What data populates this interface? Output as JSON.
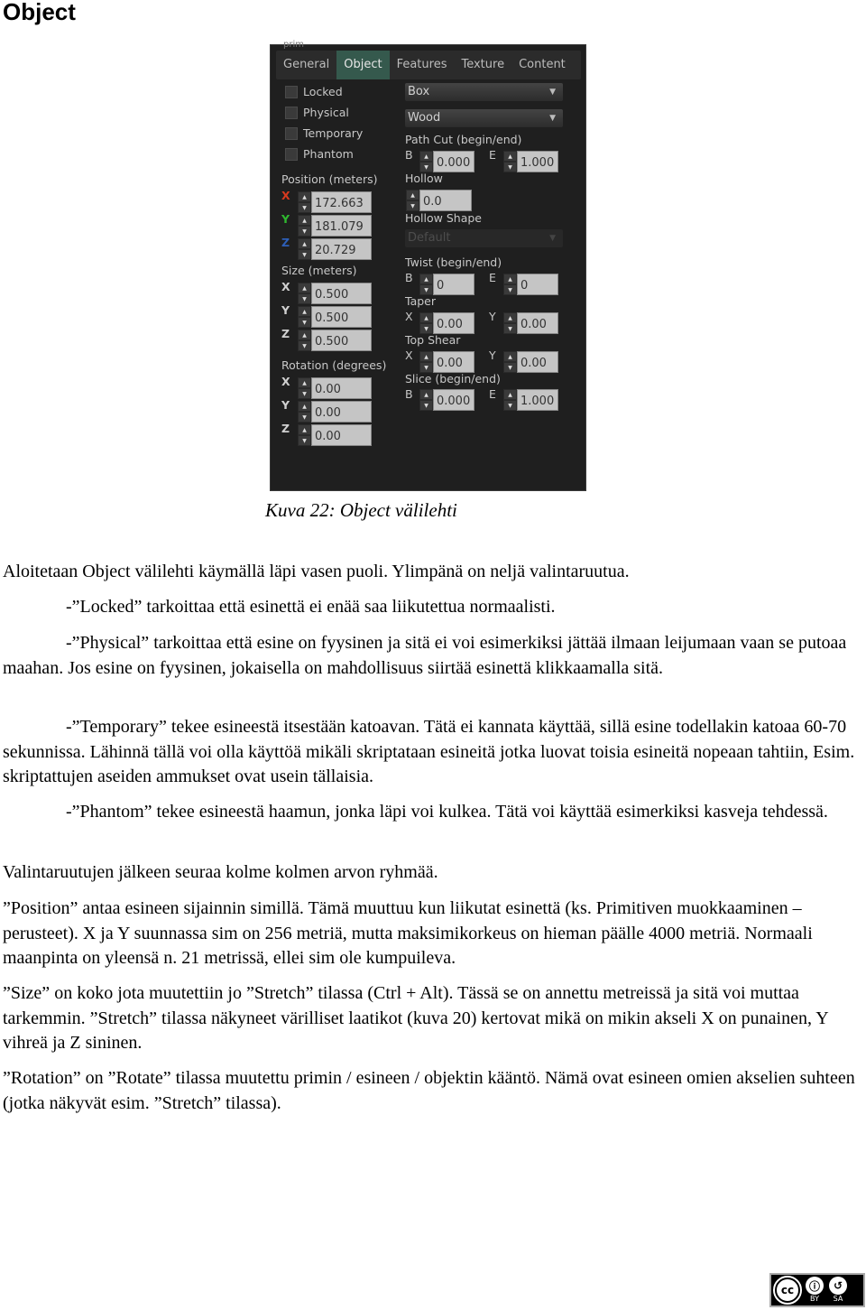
{
  "doc": {
    "title": "Object"
  },
  "panel": {
    "cut_label": "prim",
    "tabs": [
      {
        "label": "General",
        "active": false
      },
      {
        "label": "Object",
        "active": true
      },
      {
        "label": "Features",
        "active": false
      },
      {
        "label": "Texture",
        "active": false
      },
      {
        "label": "Content",
        "active": false
      }
    ],
    "checkboxes": [
      {
        "label": "Locked",
        "checked": false
      },
      {
        "label": "Physical",
        "checked": false
      },
      {
        "label": "Temporary",
        "checked": false
      },
      {
        "label": "Phantom",
        "checked": false
      }
    ],
    "position": {
      "label": "Position (meters)",
      "x_label": "X",
      "y_label": "Y",
      "z_label": "Z",
      "x": "172.663",
      "y": "181.079",
      "z": "20.729",
      "axis_colors": {
        "x": "#d83a1e",
        "y": "#2fb82f",
        "z": "#2d5fb8"
      }
    },
    "size": {
      "label": "Size (meters)",
      "x_label": "X",
      "y_label": "Y",
      "z_label": "Z",
      "x": "0.500",
      "y": "0.500",
      "z": "0.500"
    },
    "rotation": {
      "label": "Rotation (degrees)",
      "x_label": "X",
      "y_label": "Y",
      "z_label": "Z",
      "x": "0.00",
      "y": "0.00",
      "z": "0.00"
    },
    "shape_dropdown": "Box",
    "material_dropdown": "Wood",
    "path_cut": {
      "label": "Path Cut (begin/end)",
      "b_label": "B",
      "e_label": "E",
      "b": "0.000",
      "e": "1.000"
    },
    "hollow": {
      "label": "Hollow",
      "value": "0.0"
    },
    "hollow_shape": {
      "label": "Hollow Shape",
      "value": "Default"
    },
    "twist": {
      "label": "Twist (begin/end)",
      "b_label": "B",
      "e_label": "E",
      "b": "0",
      "e": "0"
    },
    "taper": {
      "label": "Taper",
      "x_label": "X",
      "y_label": "Y",
      "x": "0.00",
      "y": "0.00"
    },
    "top_shear": {
      "label": "Top Shear",
      "x_label": "X",
      "y_label": "Y",
      "x": "0.00",
      "y": "0.00"
    },
    "slice": {
      "label": "Slice (begin/end)",
      "b_label": "B",
      "e_label": "E",
      "b": "0.000",
      "e": "1.000"
    },
    "up_arrow": "▲",
    "down_arrow": "▼",
    "caret": "▼"
  },
  "caption": "Kuva 22: Object välilehti",
  "paragraphs": [
    "Aloitetaan Object välilehti käymällä läpi vasen puoli. Ylimpänä on neljä valintaruutua.",
    "-”Locked” tarkoittaa että esinettä ei enää saa liikutettua normaalisti.",
    "-”Physical” tarkoittaa että esine on fyysinen ja sitä ei voi esimerkiksi jättää ilmaan leijumaan vaan se putoaa maahan. Jos esine on fyysinen, jokaisella on mahdollisuus siirtää esinettä klikkaamalla sitä.",
    "-”Temporary” tekee esineestä itsestään katoavan. Tätä ei kannata käyttää, sillä esine todellakin katoaa 60-70 sekunnissa. Lähinnä tällä voi olla käyttöä mikäli skriptataan esineitä jotka luovat toisia esineitä nopeaan tahtiin, Esim. skriptattujen aseiden ammukset ovat usein tällaisia.",
    "-”Phantom” tekee esineestä haamun, jonka läpi voi kulkea. Tätä voi käyttää esimerkiksi kasveja tehdessä.",
    "Valintaruutujen jälkeen seuraa kolme kolmen arvon ryhmää.",
    "”Position” antaa esineen sijainnin simillä. Tämä muuttuu kun liikutat esinettä (ks. Primitiven muokkaaminen – perusteet). X ja Y suunnassa sim on 256 metriä, mutta maksimikorkeus on hieman päälle 4000 metriä. Normaali maanpinta on yleensä n. 21 metrissä, ellei sim ole kumpuileva.",
    "”Size” on koko jota muutettiin jo ”Stretch” tilassa (Ctrl + Alt). Tässä se on annettu metreissä ja sitä voi muttaa tarkemmin. ”Stretch” tilassa näkyneet värilliset laatikot (kuva 20) kertovat mikä on mikin akseli X on punainen, Y vihreä ja Z sininen.",
    "”Rotation” on ”Rotate” tilassa muutettu primin / esineen / objektin kääntö. Nämä ovat esineen omien akselien suhteen (jotka näkyvät esim. ”Stretch” tilassa)."
  ],
  "license": {
    "cc": "cc",
    "by_label": "BY",
    "sa_label": "SA",
    "by_icon": "ⓘ",
    "sa_icon": "↺"
  }
}
